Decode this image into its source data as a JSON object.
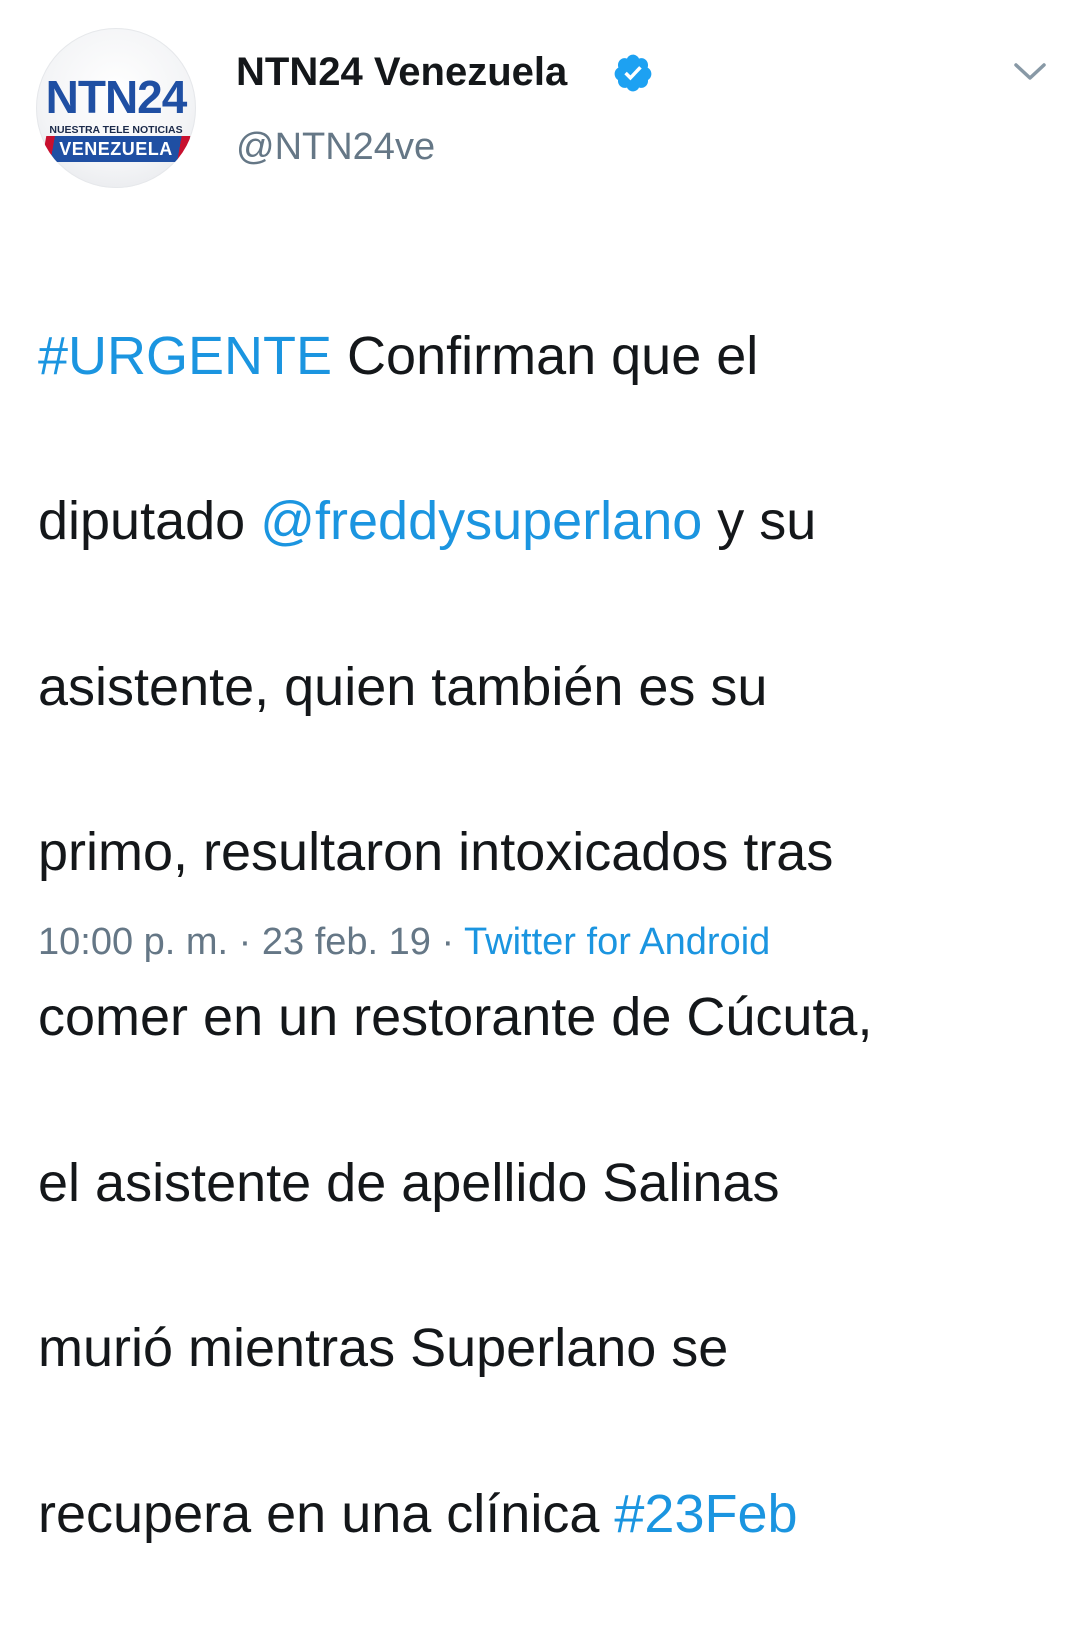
{
  "author": {
    "avatar_logo_main": "NTN24",
    "avatar_logo_sub": "NUESTRA TELE NOTICIAS",
    "avatar_logo_band": "VENEZUELA",
    "display_name": "NTN24 Venezuela",
    "handle": "@NTN24ve",
    "verified": true
  },
  "menu_icon": "chevron-down-icon",
  "tweet": {
    "lines": [
      [
        {
          "text": "#URGENTE",
          "link": true
        },
        {
          "text": " Confirman que el",
          "link": false
        }
      ],
      [
        {
          "text": "diputado ",
          "link": false
        },
        {
          "text": "@freddysuperlano",
          "link": true
        },
        {
          "text": " y su",
          "link": false
        }
      ],
      [
        {
          "text": "asistente, quien también es su",
          "link": false
        }
      ],
      [
        {
          "text": "primo, resultaron intoxicados tras",
          "link": false
        }
      ],
      [
        {
          "text": "comer en un restorante de Cúcuta,",
          "link": false
        }
      ],
      [
        {
          "text": "el asistente de apellido Salinas",
          "link": false
        }
      ],
      [
        {
          "text": "murió mientras Superlano se",
          "link": false
        }
      ],
      [
        {
          "text": "recupera en una clínica ",
          "link": false
        },
        {
          "text": "#23Feb",
          "link": true
        }
      ]
    ]
  },
  "meta": {
    "time": "10:00 p. m.",
    "separator": " · ",
    "date": "23 feb. 19",
    "source": "Twitter for Android"
  },
  "colors": {
    "link": "#1b95e0",
    "text": "#14171a",
    "secondary": "#657786",
    "verified": "#1da1f2"
  }
}
